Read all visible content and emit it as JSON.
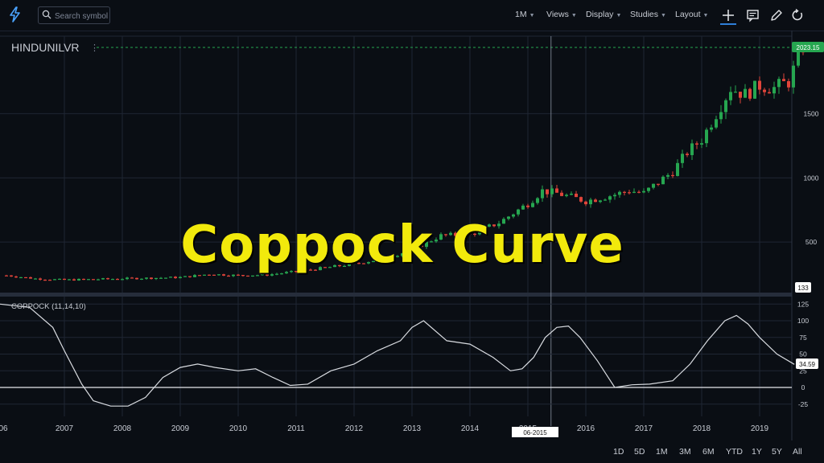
{
  "toolbar": {
    "search_placeholder": "Search symbol",
    "interval": "1M",
    "menus": [
      "Views",
      "Display",
      "Studies",
      "Layout"
    ]
  },
  "symbol": "HINDUNILVR",
  "indicator_label": "COPPOCK (11,14,10)",
  "overlay_title": "Coppock Curve",
  "crosshair_date": "06-2015",
  "ranges": [
    "1D",
    "5D",
    "1M",
    "3M",
    "6M",
    "YTD",
    "1Y",
    "5Y",
    "All"
  ],
  "colors": {
    "up": "#26a650",
    "down": "#e0443a",
    "background": "#0a0e14",
    "grid": "#1f2633",
    "accent": "#2e7fd8",
    "overlay": "#f2ea0c"
  },
  "chart_data": [
    {
      "type": "candlestick",
      "title": "HINDUNILVR",
      "interval": "1M",
      "x_tick_labels": [
        "06",
        "2007",
        "2008",
        "2009",
        "2010",
        "2011",
        "2012",
        "2013",
        "2014",
        "2015",
        "2016",
        "2017",
        "2018",
        "2019"
      ],
      "y_tick_labels": [
        "500",
        "1000",
        "1500"
      ],
      "ylim": [
        125,
        2090
      ],
      "last_price_label": "2023.15",
      "low_marker_label": "133",
      "grid": true,
      "close_points": [
        [
          2006.0,
          240
        ],
        [
          2006.5,
          215
        ],
        [
          2007.0,
          205
        ],
        [
          2007.5,
          210
        ],
        [
          2008.0,
          215
        ],
        [
          2008.5,
          220
        ],
        [
          2009.0,
          225
        ],
        [
          2009.5,
          250
        ],
        [
          2010.0,
          240
        ],
        [
          2010.5,
          245
        ],
        [
          2011.0,
          270
        ],
        [
          2011.5,
          300
        ],
        [
          2012.0,
          330
        ],
        [
          2012.5,
          370
        ],
        [
          2013.0,
          440
        ],
        [
          2013.5,
          550
        ],
        [
          2014.0,
          560
        ],
        [
          2014.5,
          650
        ],
        [
          2015.0,
          800
        ],
        [
          2015.25,
          900
        ],
        [
          2015.5,
          880
        ],
        [
          2016.0,
          820
        ],
        [
          2016.5,
          870
        ],
        [
          2016.75,
          900
        ],
        [
          2017.0,
          880
        ],
        [
          2017.5,
          1050
        ],
        [
          2017.75,
          1200
        ],
        [
          2018.0,
          1300
        ],
        [
          2018.25,
          1500
        ],
        [
          2018.5,
          1700
        ],
        [
          2018.75,
          1650
        ],
        [
          2019.0,
          1720
        ],
        [
          2019.25,
          1700
        ],
        [
          2019.5,
          1750
        ],
        [
          2019.75,
          2023.15
        ]
      ]
    },
    {
      "type": "line",
      "title": "COPPOCK (11,14,10)",
      "y_tick_labels": [
        "125",
        "100",
        "75",
        "50",
        "25",
        "0",
        "-25"
      ],
      "ylim": [
        -35,
        133
      ],
      "last_value_label": "34.59",
      "zero_line": true,
      "x": [
        2006.0,
        2006.4,
        2006.8,
        2007.0,
        2007.3,
        2007.5,
        2007.8,
        2008.1,
        2008.4,
        2008.7,
        2009.0,
        2009.3,
        2009.6,
        2010.0,
        2010.3,
        2010.6,
        2010.9,
        2011.2,
        2011.6,
        2012.0,
        2012.4,
        2012.8,
        2013.0,
        2013.2,
        2013.6,
        2014.0,
        2014.4,
        2014.7,
        2014.9,
        2015.1,
        2015.3,
        2015.5,
        2015.7,
        2015.9,
        2016.2,
        2016.5,
        2016.8,
        2017.1,
        2017.5,
        2017.8,
        2018.1,
        2018.4,
        2018.6,
        2018.8,
        2019.0,
        2019.3,
        2019.6
      ],
      "y": [
        125,
        120,
        90,
        55,
        5,
        -20,
        -28,
        -28,
        -15,
        15,
        30,
        35,
        30,
        25,
        28,
        15,
        3,
        5,
        25,
        35,
        55,
        70,
        90,
        100,
        70,
        65,
        45,
        25,
        28,
        45,
        75,
        90,
        92,
        75,
        40,
        0,
        4,
        5,
        10,
        35,
        70,
        100,
        108,
        95,
        75,
        50,
        34.59
      ]
    }
  ]
}
